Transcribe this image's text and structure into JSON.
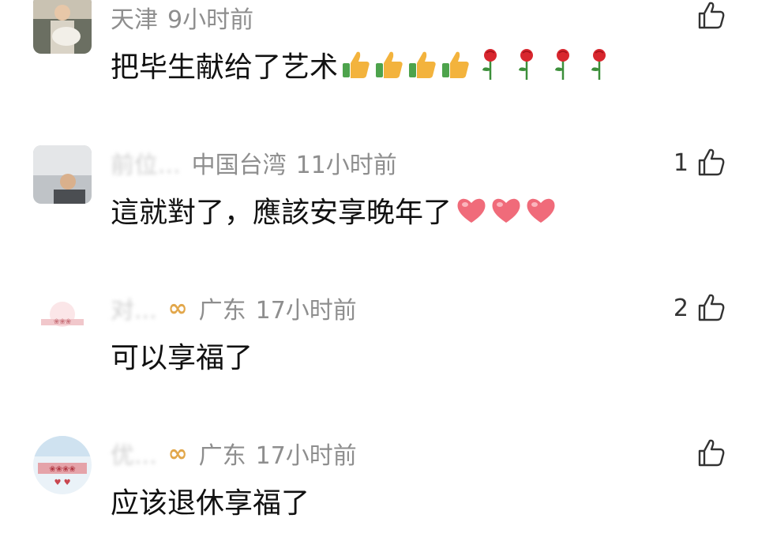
{
  "comments": [
    {
      "location": "天津",
      "time": "9小时前",
      "text": "把毕生献给了艺术",
      "likes": "",
      "emoji": [
        "thumbs-up",
        "thumbs-up",
        "thumbs-up",
        "thumbs-up",
        "rose",
        "rose",
        "rose",
        "rose"
      ]
    },
    {
      "username_obscured": "前位...",
      "location": "中国台湾",
      "time": "11小时前",
      "text": "這就對了，應該安享晚年了",
      "likes": "1",
      "emoji": [
        "heart",
        "heart",
        "heart"
      ]
    },
    {
      "username_obscured": "对...",
      "badge": "∞",
      "location": "广东",
      "time": "17小时前",
      "text": "可以享福了",
      "likes": "2"
    },
    {
      "username_obscured": "优...",
      "badge": "∞",
      "location": "广东",
      "time": "17小时前",
      "text": "应该退休享福了",
      "likes": ""
    }
  ],
  "colors": {
    "meta": "#8e8e8e",
    "badge": "#e2a74b",
    "heart": "#f06b7a",
    "thumb": "#f3b33d"
  }
}
